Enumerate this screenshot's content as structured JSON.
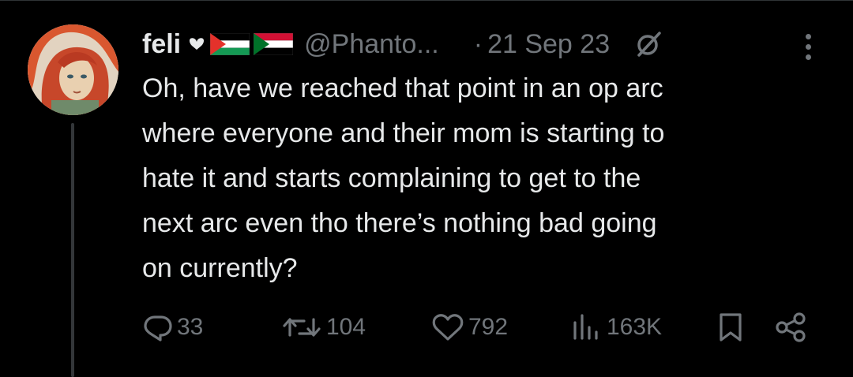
{
  "tweet": {
    "author_name": "feli",
    "handle": "@Phanto...",
    "separator": "·",
    "date": "21 Sep 23",
    "text_lines": [
      "Oh, have we reached that point in an op arc",
      "where everyone and their mom is starting to",
      "hate it and starts complaining to get to the",
      "next arc even tho there’s nothing bad going",
      "on currently?"
    ],
    "name_decorations": [
      "heart-icon",
      "palestine-flag-icon",
      "sudan-flag-icon"
    ]
  },
  "actions": {
    "replies": "33",
    "reposts": "104",
    "likes": "792",
    "views": "163K"
  },
  "colors": {
    "background": "#000000",
    "text": "#e7e9ea",
    "muted": "#71767b",
    "thread_line": "#333639"
  }
}
